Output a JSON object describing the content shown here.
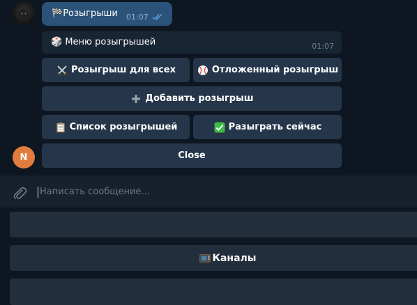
{
  "colors": {
    "chat_bg": "#0e1621",
    "outgoing_bubble": "#2b5278",
    "incoming_bubble": "#182533",
    "inline_button": "#26364a",
    "composer_bg": "#17212b",
    "reply_button": "#232e3c",
    "read_ticks": "#5fa8e8",
    "user_avatar": "#e07d3e"
  },
  "outgoing_message": {
    "icon": "checkered-flag-icon",
    "emoji": "🏁",
    "text": "Розыгрыши",
    "time": "01:07",
    "status": "read"
  },
  "bot_message": {
    "icon": "die-icon",
    "emoji": "🎲",
    "text": "Меню розыгрышей",
    "time": "01:07"
  },
  "inline_keyboard": {
    "giveaway_all": {
      "icon": "crossed-swords-icon",
      "emoji": "⚔️",
      "label": "Розыгрыш для всех"
    },
    "delayed_giveaway": {
      "icon": "baseball-icon",
      "emoji": "⚾",
      "label": "Отложенный розыгрыш"
    },
    "add_giveaway": {
      "icon": "plus-icon",
      "emoji": "➕",
      "label": "Добавить розыгрыш"
    },
    "giveaway_list": {
      "icon": "clipboard-icon",
      "emoji": "📋",
      "label": "Список розыгрышей"
    },
    "draw_now": {
      "icon": "check-mark-icon",
      "emoji": "✅",
      "label": "Разыграть сейчас"
    },
    "close": {
      "label": "Close"
    }
  },
  "user_avatar": {
    "initial": "N"
  },
  "composer": {
    "placeholder": "Написать сообщение..."
  },
  "reply_keyboard": {
    "row1": {
      "label": ""
    },
    "row2": {
      "icon": "television-icon",
      "emoji": "📺",
      "label": "Каналы"
    },
    "row3": {
      "label": ""
    }
  }
}
